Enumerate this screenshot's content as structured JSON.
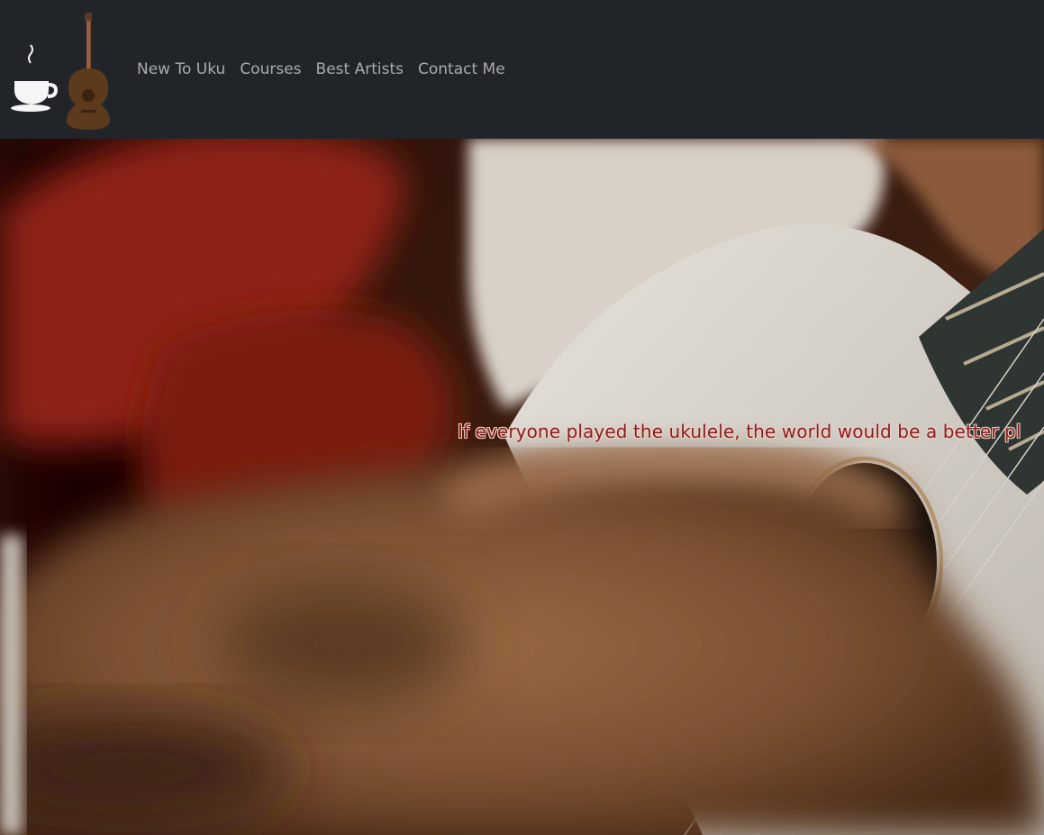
{
  "nav": {
    "logo_icons": [
      "coffee-cup-icon",
      "ukulele-icon"
    ],
    "links": [
      {
        "label": "New To Uku"
      },
      {
        "label": "Courses"
      },
      {
        "label": "Best Artists"
      },
      {
        "label": "Contact Me"
      }
    ]
  },
  "hero": {
    "quote": "If everyone played the ukulele, the world would be a better pl",
    "quote_color": "#8a1f24"
  },
  "colors": {
    "navbar_bg": "#212529",
    "nav_link": "#a9abae"
  }
}
